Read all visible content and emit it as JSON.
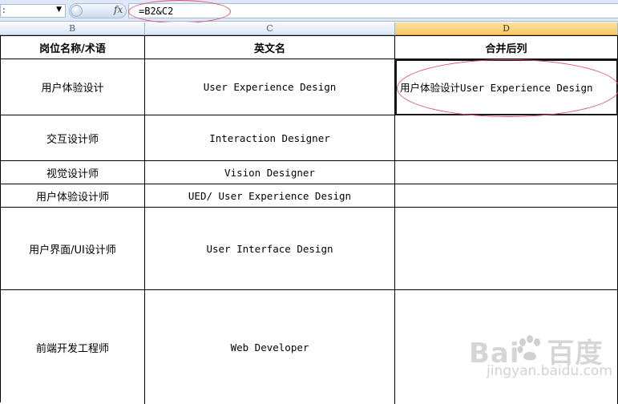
{
  "formula_bar": {
    "name_box_value": ":",
    "fx_label": "fx",
    "formula": "=B2&C2"
  },
  "columns": [
    "B",
    "C",
    "D"
  ],
  "header_row": [
    "岗位名称/术语",
    "英文名",
    "合并后列"
  ],
  "rows": [
    {
      "b": "用户体验设计",
      "c": "User Experience Design",
      "d": "用户体验设计User Experience Design"
    },
    {
      "b": "交互设计师",
      "c": "Interaction Designer",
      "d": ""
    },
    {
      "b": "视觉设计师",
      "c": "Vision Designer",
      "d": ""
    },
    {
      "b": "用户体验设计师",
      "c": "UED/ User Experience Design",
      "d": ""
    },
    {
      "b": "用户界面/UI设计师",
      "c": "User Interface Design",
      "d": ""
    },
    {
      "b": "前端开发工程师",
      "c": "Web Developer",
      "d": ""
    }
  ],
  "watermark": {
    "logo_left": "Bai",
    "logo_right": "百度",
    "sub": "jingyan.baidu.com"
  },
  "colors": {
    "active_column_header": "#f7c766",
    "annotation_ellipse": "#e0506c"
  }
}
